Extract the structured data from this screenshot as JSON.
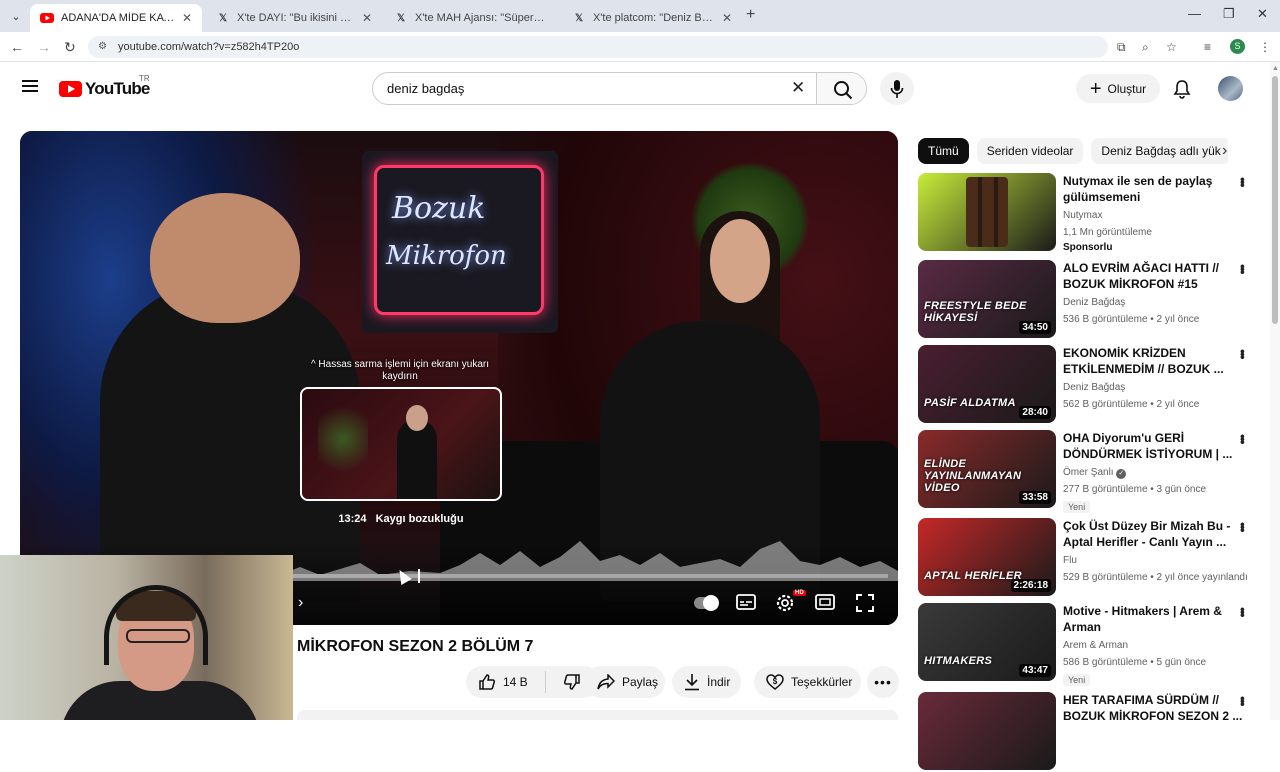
{
  "browser": {
    "tabs": [
      {
        "title": "ADANA'DA MİDE KATLİAMI // B",
        "favicon": "youtube-icon",
        "active": true
      },
      {
        "title": "X'te DAYI: \"Bu ikisini kahvaltıda",
        "favicon": "x-icon",
        "active": false
      },
      {
        "title": "X'te MAH Ajansı: \"Süper Lig'de",
        "favicon": "x-icon",
        "active": false
      },
      {
        "title": "X'te platcom: \"Deniz Bağdaş, In",
        "favicon": "x-icon",
        "active": false
      }
    ],
    "url": "youtube.com/watch?v=z582h4TP20o",
    "profile_initial": "S"
  },
  "header": {
    "logo_text": "YouTube",
    "country_code": "TR",
    "search_value": "deniz bagdaş",
    "create_label": "Oluştur"
  },
  "player": {
    "neon_line1": "Bozuk",
    "neon_line2": "Mikrofon",
    "hint": "^ Hassas sarma işlemi için ekranı yukarı kaydırın",
    "chapter_time": "13:24",
    "chapter_title": "Kaygı bozukluğu",
    "progress_fraction": 0.17,
    "preview_fraction": 0.21,
    "hd_badge": "HD"
  },
  "video": {
    "title": "MİKROFON SEZON 2 BÖLÜM 7",
    "likes": "14 B",
    "share_label": "Paylaş",
    "download_label": "İndir",
    "thanks_label": "Teşekkürler"
  },
  "sidebar": {
    "chips": [
      "Tümü",
      "Seriden videolar",
      "Deniz Bağdaş adlı yük"
    ],
    "items": [
      {
        "title": "Nutymax ile sen de paylaş\ngülümsemeni",
        "channel": "Nutymax",
        "meta": "1,1 Mn görüntüleme",
        "badge": "",
        "sponsored": "Sponsorlu",
        "duration": "",
        "thumb_text": "",
        "verified": false,
        "thumb_color": "#c8ec3a"
      },
      {
        "title": "ALO EVRİM AĞACI HATTI //\nBOZUK MİKROFON #15",
        "channel": "Deniz Bağdaş",
        "meta": "536 B görüntüleme • 2 yıl önce",
        "badge": "",
        "sponsored": "",
        "duration": "34:50",
        "thumb_text": "FREESTYLE BEDE HİKAYESİ",
        "verified": false,
        "thumb_color": "#5a2a44"
      },
      {
        "title": "EKONOMİK KRİZDEN\nETKİLENMEDİM // BOZUK ...",
        "channel": "Deniz Bağdaş",
        "meta": "562 B görüntüleme • 2 yıl önce",
        "badge": "",
        "sponsored": "",
        "duration": "28:40",
        "thumb_text": "PASİF ALDATMA",
        "verified": false,
        "thumb_color": "#4a1e30"
      },
      {
        "title": "OHA Diyorum'u GERİ\nDÖNDÜRMEK İSTİYORUM | ...",
        "channel": "Ömer Şanlı",
        "meta": "277 B görüntüleme • 3 gün önce",
        "badge": "Yeni",
        "sponsored": "",
        "duration": "33:58",
        "thumb_text": "ELİNDE YAYINLANMAYAN VİDEO",
        "verified": true,
        "thumb_color": "#8a2a2a"
      },
      {
        "title": "Çok Üst Düzey Bir Mizah Bu -\nAptal Herifler - Canlı Yayın ...",
        "channel": "Flu",
        "meta": "529 B görüntüleme • 2 yıl önce yayınlandı",
        "badge": "",
        "sponsored": "",
        "duration": "2:26:18",
        "thumb_text": "APTAL HERİFLER",
        "verified": false,
        "thumb_color": "#c62828"
      },
      {
        "title": "Motive - Hitmakers | Arem &\nArman",
        "channel": "Arem & Arman",
        "meta": "586 B görüntüleme • 5 gün önce",
        "badge": "Yeni",
        "sponsored": "",
        "duration": "43:47",
        "thumb_text": "HITMAKERS",
        "verified": false,
        "thumb_color": "#3a3a3a"
      },
      {
        "title": "HER TARAFIMA SÜRDÜM //\nBOZUK MİKROFON SEZON 2 ...",
        "channel": "",
        "meta": "",
        "badge": "",
        "sponsored": "",
        "duration": "",
        "thumb_text": "",
        "verified": false,
        "thumb_color": "#6a2a3a"
      }
    ]
  }
}
